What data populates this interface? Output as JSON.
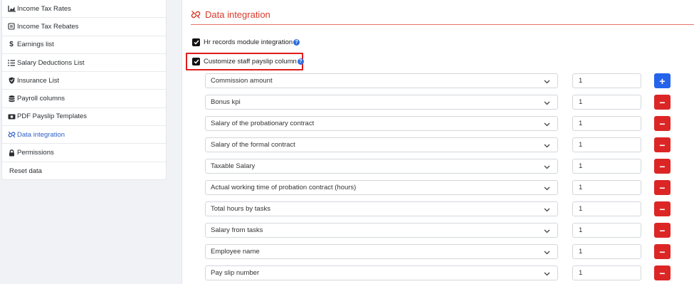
{
  "sidebar": {
    "items": [
      {
        "label": "Income Tax Rates",
        "icon": "chart-area-icon",
        "active": false
      },
      {
        "label": "Income Tax Rebates",
        "icon": "receipt-icon",
        "active": false
      },
      {
        "label": "Earnings list",
        "icon": "dollar-icon",
        "active": false
      },
      {
        "label": "Salary Deductions List",
        "icon": "list-icon",
        "active": false
      },
      {
        "label": "Insurance List",
        "icon": "shield-icon",
        "active": false
      },
      {
        "label": "Payroll columns",
        "icon": "database-icon",
        "active": false
      },
      {
        "label": "PDF Payslip Templates",
        "icon": "money-bill-icon",
        "active": false
      },
      {
        "label": "Data integration",
        "icon": "unlink-icon",
        "active": true
      },
      {
        "label": "Permissions",
        "icon": "lock-icon",
        "active": false
      },
      {
        "label": "Reset data",
        "icon": "",
        "active": false
      }
    ]
  },
  "main": {
    "title": "Data integration",
    "hr_integration_label": "Hr records module integration",
    "customize_label": "Customize staff payslip column",
    "help_glyph": "?",
    "add_glyph": "+",
    "remove_glyph": "−",
    "rows": [
      {
        "column": "Commission amount",
        "value": "1",
        "action": "add"
      },
      {
        "column": "Bonus kpi",
        "value": "1",
        "action": "remove"
      },
      {
        "column": "Salary of the probationary contract",
        "value": "1",
        "action": "remove"
      },
      {
        "column": "Salary of the formal contract",
        "value": "1",
        "action": "remove"
      },
      {
        "column": "Taxable Salary",
        "value": "1",
        "action": "remove"
      },
      {
        "column": "Actual working time of probation contract (hours)",
        "value": "1",
        "action": "remove"
      },
      {
        "column": "Total hours by tasks",
        "value": "1",
        "action": "remove"
      },
      {
        "column": "Salary from tasks",
        "value": "1",
        "action": "remove"
      },
      {
        "column": "Employee name",
        "value": "1",
        "action": "remove"
      },
      {
        "column": "Pay slip number",
        "value": "1",
        "action": "remove"
      }
    ]
  },
  "colors": {
    "accent_red": "#d83b2c",
    "active_blue": "#2f5fc4",
    "add_blue": "#2563eb",
    "remove_red": "#dc2626",
    "highlight_red": "#e21b1b"
  }
}
